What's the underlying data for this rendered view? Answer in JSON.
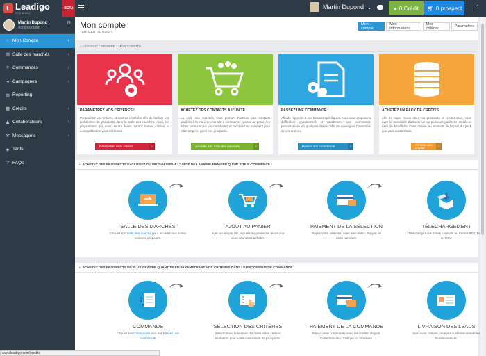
{
  "header": {
    "logo_name": "Leadigo",
    "logo_tagline": "B2B & B2C",
    "beta_label": "BETA",
    "user_name": "Martin Dupond",
    "credit_label": "0 Crédit",
    "prospect_label": "0 prospect"
  },
  "sidebar": {
    "user_name": "Martin Dupond",
    "user_role": "Administration",
    "items": [
      {
        "label": "Mon Compte",
        "icon": "home-icon",
        "active": true
      },
      {
        "label": "Salle des marchés",
        "icon": "cart-icon"
      },
      {
        "label": "Commandes",
        "icon": "list-icon"
      },
      {
        "label": "Campagnes",
        "icon": "megaphone-icon"
      },
      {
        "label": "Reporting",
        "icon": "chart-icon"
      },
      {
        "label": "Crédits",
        "icon": "coins-icon"
      },
      {
        "label": "Collaborateurs",
        "icon": "users-icon"
      },
      {
        "label": "Messagerie",
        "icon": "envelope-icon"
      },
      {
        "label": "Tarifs",
        "icon": "tag-icon"
      },
      {
        "label": "FAQs",
        "icon": "question-icon"
      }
    ]
  },
  "page": {
    "title": "Mon compte",
    "subtitle": "TABLEAU DE BORD",
    "tabs": [
      "Mon compte",
      "Mes informations",
      "Mes critères",
      "Paramètres"
    ],
    "breadcrumb": [
      "LEADIGO",
      "MEMBRE",
      "MON COMPTE"
    ]
  },
  "cards": [
    {
      "title": "PARAMÉTREZ VOS CRITÈRES !",
      "desc": "Paramétrez vos critères et centres d'intérêts afin de faciliter vos recherches de prospects dans la salle des marchés. Ainsi, les propositions qui vous seront faites seront toutes ciblées et susceptibles de vous intéresser.",
      "button": "Paramétrer mes critères",
      "color": "#e8334a",
      "btn_color": "#d0263c"
    },
    {
      "title": "ACHETEZ DES CONTACTS À L'UNITÉ",
      "desc": "La salle des marchés vous permet d'acheter des contacts qualifiés à la manière d'un site e-commerce. Ajoutez au panier les fiches contacts que vous souhaitez et procédez au paiement pour télécharger et gérer vos prospects.",
      "button": "Accéder à la salle des marchés",
      "color": "#8cc63f",
      "btn_color": "#7bb22f"
    },
    {
      "title": "PASSEZ UNE COMMANDE !",
      "desc": "Afin de répondre à vos besoins spécifiques, nous vous proposons d'effectuer gratuitement et rapidement une commande personnalisée en quelques étapes afin de renseigner l'ensemble de vos critères.",
      "button": "Passer une commande",
      "color": "#2fa6e0",
      "btn_color": "#2a8ec4"
    },
    {
      "title": "ACHETEZ UN PACK DE CRÉDITS",
      "desc": "Afin de payer moins cher vos prospects et rendez-vous, vous avez la possibilité d'acheter un ou plusieurs packs de crédits et ainsi de bénéficier d'une remise au moment de l'achat du pack que vous aurez choisi.",
      "button": "Acheter des crédits",
      "color": "#f6a43c",
      "btn_color": "#ef9a2c"
    }
  ],
  "section1": {
    "heading": "ACHETEZ DES PROSPECTS EXCLUSIFS OU MUTUALISÉS À L'UNITÉ DE LA MÊME MANIÈRE QU'UN SITE E-COMMERCE !",
    "steps": [
      {
        "title": "SALLE DES MARCHÉS",
        "icon": "laptop-icon",
        "desc_pre": "Cliquez sur ",
        "desc_link": "Salle des marché",
        "desc_post": " pour accéder aux fiches contacts proposés."
      },
      {
        "title": "AJOUT AU PANIER",
        "icon": "shopping-cart-icon",
        "desc_pre": "Avec un simple clic, ajoutez au panier les leads que vous souhaitez acheter.",
        "desc_link": "",
        "desc_post": ""
      },
      {
        "title": "PAIEMENT DE LA SÉLECTION",
        "icon": "credit-card-icon",
        "desc_pre": "Payez votre sélection avec les crédits, Paypal ou carte bancaire.",
        "desc_link": "",
        "desc_post": ""
      },
      {
        "title": "TÉLÉCHARGEMENT",
        "icon": "download-box-icon",
        "desc_pre": "Téléchargez vos fiches contacts au format PDF, Excel ou CSV.",
        "desc_link": "",
        "desc_post": ""
      }
    ]
  },
  "section2": {
    "heading": "ACHETEZ DES PROSPECTS EN PLUS GRANDE QUANTITÉ EN PARAMÉTRANT VOS CRITÈRES DANS LE PROCESSUS DE COMMANDE !",
    "steps": [
      {
        "title": "COMMANDE",
        "icon": "document-icon",
        "desc_pre": "Cliquez sur ",
        "desc_link": "Commande",
        "desc_mid": " puis sur ",
        "desc_link2": "Passer une commande"
      },
      {
        "title": "SÉLECTION DES CRITÈRES",
        "icon": "hand-pointer-icon",
        "desc_pre": "Sélectionnez le secteur d'activité et les critères souhaités pour votre commande de prospects."
      },
      {
        "title": "PAIEMENT DE LA COMMANDE",
        "icon": "payment-icon",
        "desc_pre": "Payez votre commande avec les crédits, Paypal, Carte bancaire, Chèque ou Virement."
      },
      {
        "title": "LIVRAISON DES LEADS",
        "icon": "contact-cards-icon",
        "desc_pre": "Selon vos critères, recevez quotidiennement les fiches contacts."
      }
    ]
  },
  "status_url": "www.leadigo.com/credits"
}
